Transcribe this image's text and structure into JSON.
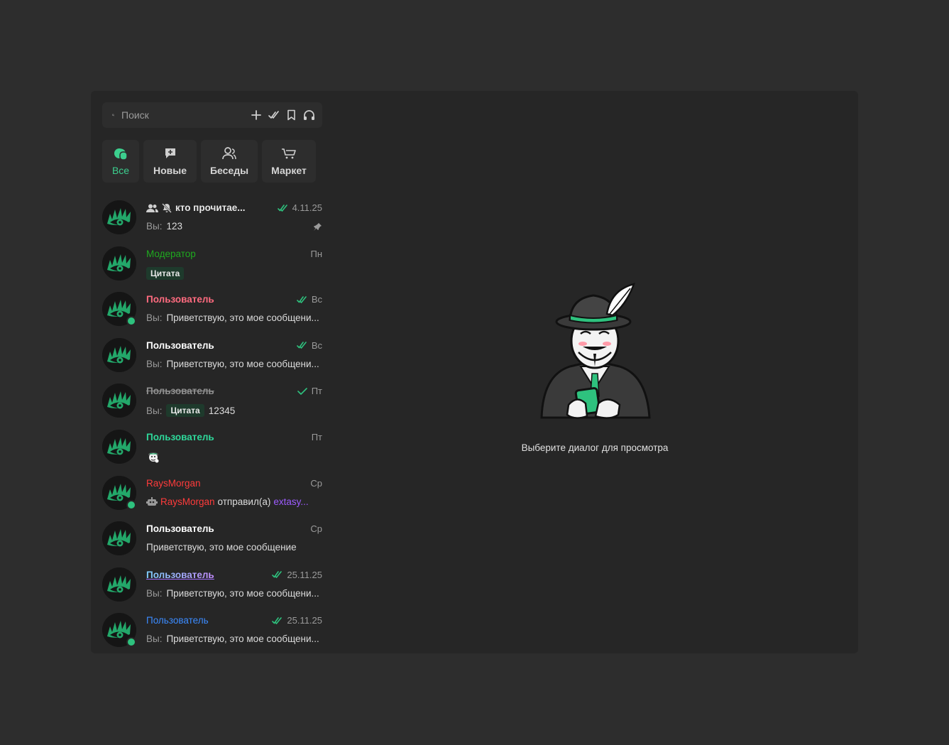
{
  "search": {
    "placeholder": "Поиск"
  },
  "toolbar_icons": [
    "plus-icon",
    "double-check-icon",
    "bookmark-icon",
    "headphones-icon"
  ],
  "tabs": [
    {
      "label": "Все",
      "icon": "chats-icon",
      "active": true
    },
    {
      "label": "Новые",
      "icon": "new-message-icon",
      "active": false
    },
    {
      "label": "Беседы",
      "icon": "group-icon",
      "active": false
    },
    {
      "label": "Маркет",
      "icon": "cart-icon",
      "active": false
    }
  ],
  "colors": {
    "accent": "#3ccf8e",
    "moderator": "#1fa91f",
    "pink": "#ff6b7f",
    "red": "#ff3b3b",
    "blue": "#3b8bff",
    "teal": "#2ed89a",
    "purple": "#9d5cff",
    "online": "#2ec27e"
  },
  "chats": [
    {
      "title": "кто прочитае...",
      "time": "4.11.25",
      "you": "Вы:",
      "preview": "123",
      "pinned": true
    },
    {
      "title": "Модератор",
      "time": "Пн",
      "quote": "Цитата"
    },
    {
      "title": "Пользователь",
      "time": "Вс",
      "you": "Вы:",
      "preview": "Приветствую, это мое сообщени..."
    },
    {
      "title": "Пользователь",
      "time": "Вс",
      "you": "Вы:",
      "preview": "Приветствую, это мое сообщени..."
    },
    {
      "title": "Пользователь",
      "time": "Пт",
      "you": "Вы:",
      "quote": "Цитата",
      "preview": "12345"
    },
    {
      "title": "Пользователь",
      "time": "Пт",
      "sticker": "mascot-sticker-icon"
    },
    {
      "title": "RaysMorgan",
      "time": "Ср",
      "sys_user": "RaysMorgan",
      "sys_action": "отправил(а)",
      "sys_target": "extasy..."
    },
    {
      "title": "Пользователь",
      "time": "Ср",
      "preview": "Приветствую, это мое сообщение"
    },
    {
      "title": "Пользователь",
      "time": "25.11.25",
      "you": "Вы:",
      "preview": "Приветствую, это мое сообщени..."
    },
    {
      "title": "Пользователь",
      "time": "25.11.25",
      "you": "Вы:",
      "preview": "Приветствую, это мое сообщени..."
    }
  ],
  "empty_state": {
    "text": "Выберите диалог для просмотра",
    "illustration": "hacker-mascot-illustration"
  }
}
